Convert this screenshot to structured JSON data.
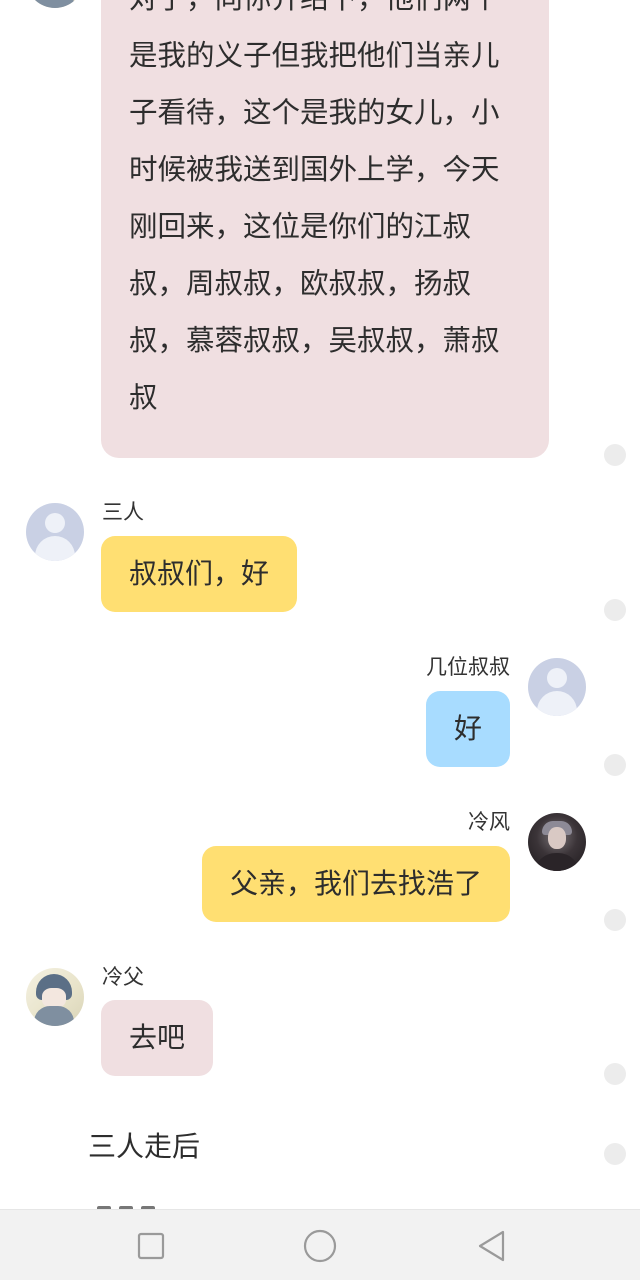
{
  "chat": {
    "long_message": "对了，向你介绍下，他们两个\n是我的义子但我把他们当亲儿\n子看待，这个是我的女儿，小\n时候被我送到国外上学，今天\n刚回来，这位是你们的江叔\n叔，周叔叔，欧叔叔，扬叔\n叔，慕蓉叔叔，吴叔叔，萧叔\n叔",
    "messages": [
      {
        "sender": "三人",
        "text": "叔叔们，好"
      },
      {
        "sender": "几位叔叔",
        "text": "好"
      },
      {
        "sender": "冷风",
        "text": "父亲，我们去找浩了"
      },
      {
        "sender": "冷父",
        "text": "去吧"
      }
    ],
    "narration": "三人走后"
  },
  "colors": {
    "pink_bubble": "#f0dfe1",
    "yellow_bubble": "#ffdf72",
    "blue_bubble": "#a8dcff"
  },
  "navbar": {
    "icons": [
      "recent-apps-icon",
      "home-icon",
      "back-icon"
    ]
  }
}
